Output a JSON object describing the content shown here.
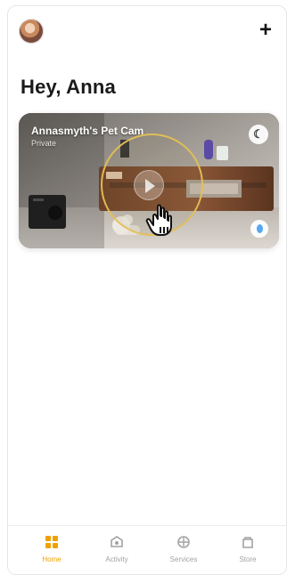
{
  "header": {
    "avatar_icon": "user-avatar-icon",
    "add_icon": "plus-icon",
    "add_label": "+"
  },
  "greeting": "Hey, Anna",
  "camera": {
    "title": "Annasmyth's Pet Cam",
    "subtitle": "Private",
    "mode_icon": "moon-icon",
    "status_icon": "blue-status-dot-icon",
    "playback_icon": "play-icon",
    "pointer_icon": "hand-pointer-icon"
  },
  "tabs": [
    {
      "label": "Home",
      "icon": "home-grid-icon",
      "color": "#f0a000"
    },
    {
      "label": "Activity",
      "icon": "activity-icon",
      "color": "#a2a2a2"
    },
    {
      "label": "Services",
      "icon": "services-icon",
      "color": "#a2a2a2"
    },
    {
      "label": "Store",
      "icon": "store-icon",
      "color": "#a2a2a2"
    }
  ]
}
